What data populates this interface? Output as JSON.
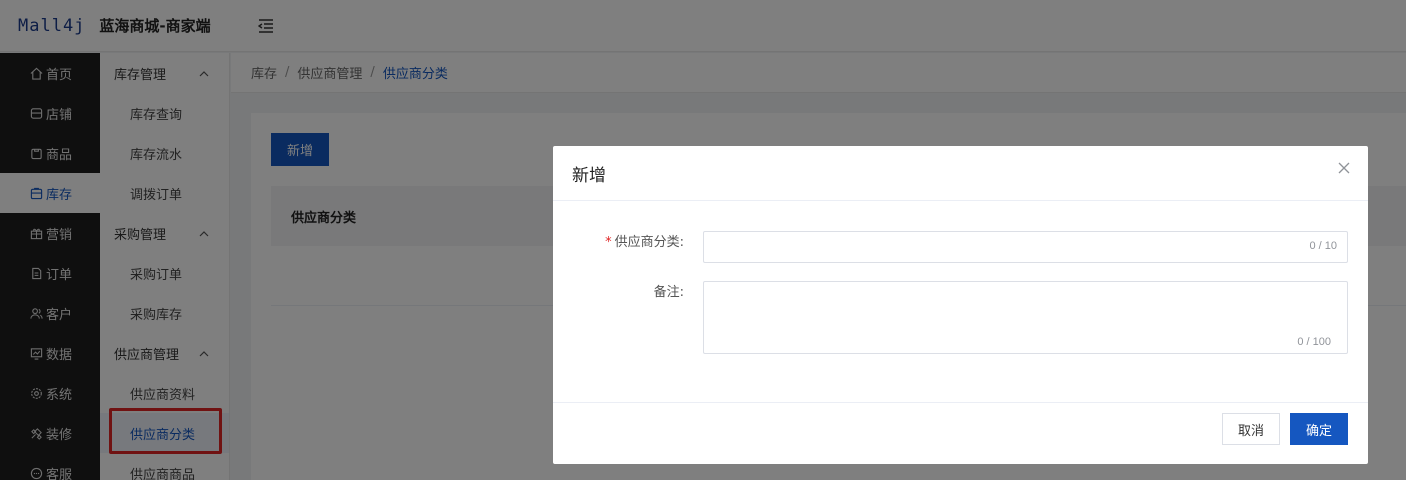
{
  "header": {
    "logo": "Mall4j",
    "shop_name": "蓝海商城-商家端"
  },
  "menu": {
    "items": [
      {
        "label": "首页",
        "icon": "home-icon"
      },
      {
        "label": "店铺",
        "icon": "shop-icon"
      },
      {
        "label": "商品",
        "icon": "goods-icon"
      },
      {
        "label": "库存",
        "icon": "inventory-icon"
      },
      {
        "label": "营销",
        "icon": "gift-icon"
      },
      {
        "label": "订单",
        "icon": "order-icon"
      },
      {
        "label": "客户",
        "icon": "customer-icon"
      },
      {
        "label": "数据",
        "icon": "data-icon"
      },
      {
        "label": "系统",
        "icon": "settings-icon"
      },
      {
        "label": "装修",
        "icon": "decoration-icon"
      },
      {
        "label": "客服",
        "icon": "chat-icon"
      }
    ],
    "active": "库存"
  },
  "submenu": {
    "groups": [
      {
        "label": "库存管理",
        "items": [
          "库存查询",
          "库存流水",
          "调拨订单"
        ]
      },
      {
        "label": "采购管理",
        "items": [
          "采购订单",
          "采购库存"
        ]
      },
      {
        "label": "供应商管理",
        "items": [
          "供应商资料",
          "供应商分类",
          "供应商商品"
        ]
      }
    ],
    "active_item": "供应商分类"
  },
  "breadcrumb": {
    "items": [
      "库存",
      "供应商管理"
    ],
    "current": "供应商分类",
    "separator": "/"
  },
  "page": {
    "add_button": "新增",
    "table_header": "供应商分类"
  },
  "dialog": {
    "title": "新增",
    "fields": {
      "category": {
        "required_mark": "*",
        "label": "供应商分类:",
        "value": "",
        "counter": "0 / 10"
      },
      "remark": {
        "label": "备注:",
        "value": "",
        "counter": "0 / 100"
      }
    },
    "cancel": "取消",
    "confirm": "确定"
  },
  "colors": {
    "primary": "#1557c0",
    "menu_bg": "#1f1f1f",
    "highlight_box": "#e02424"
  }
}
